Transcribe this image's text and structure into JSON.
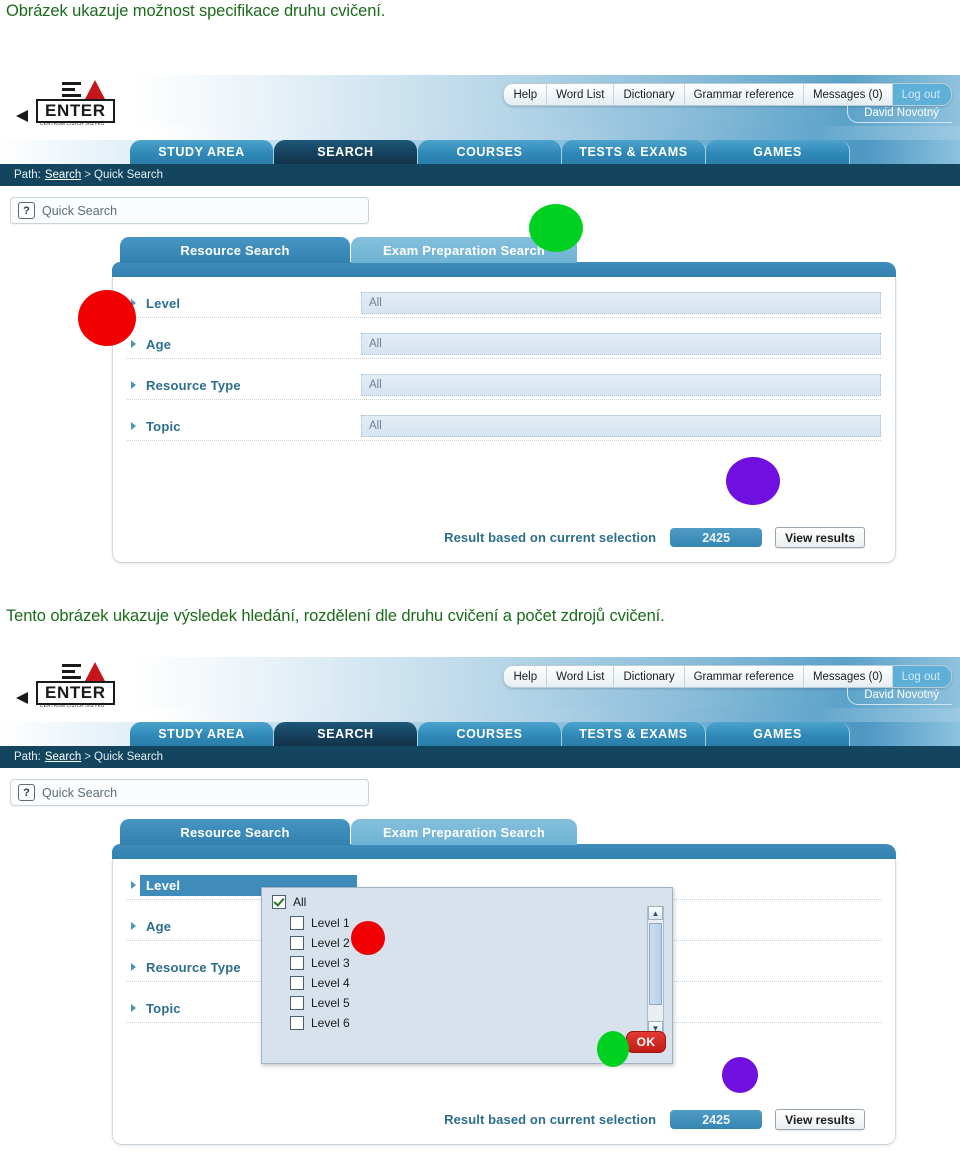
{
  "captions": {
    "first": "Obrázek ukazuje možnost specifikace druhu cvičení.",
    "second": "Tento obrázek ukazuje výsledek hledání, rozdělení dle druhu cvičení a počet zdrojů cvičení."
  },
  "colors": {
    "caption_green": "#1b6b1b",
    "header_blue": "#3382b1",
    "active_tab_navy": "#153f5b",
    "path_bar": "#13465e",
    "blob_red": "#f00000",
    "blob_green": "#00d020",
    "blob_purple": "#7010e0",
    "ok_red": "#c21d14"
  },
  "logo": {
    "word": "ENTER",
    "subtitle": "CENTRUM CIZÍCH JAZYKŮ",
    "url": "www.iENTER.cz"
  },
  "topnav": {
    "items": [
      {
        "label": "Help"
      },
      {
        "label": "Word List"
      },
      {
        "label": "Dictionary"
      },
      {
        "label": "Grammar reference"
      },
      {
        "label": "Messages (0)"
      },
      {
        "label": "Log out"
      }
    ],
    "user": "David Novotný"
  },
  "mainmenu": {
    "tabs": [
      {
        "label": "STUDY AREA",
        "active": false
      },
      {
        "label": "SEARCH",
        "active": true
      },
      {
        "label": "COURSES",
        "active": false
      },
      {
        "label": "TESTS & EXAMS",
        "active": false
      },
      {
        "label": "GAMES",
        "active": false
      }
    ]
  },
  "breadcrumb": {
    "prefix": "Path:",
    "link": "Search",
    "separator": ">",
    "current": "Quick Search"
  },
  "quick_search": {
    "icon": "question-mark-icon",
    "label": "Quick Search"
  },
  "panel": {
    "tabs": [
      {
        "label": "Resource Search",
        "active": true
      },
      {
        "label": "Exam Preparation Search",
        "active": false
      }
    ],
    "rows": [
      {
        "label": "Level",
        "value": "All"
      },
      {
        "label": "Age",
        "value": "All"
      },
      {
        "label": "Resource Type",
        "value": "All"
      },
      {
        "label": "Topic",
        "value": "All"
      }
    ],
    "footer": {
      "text": "Result based on current selection",
      "count": "2425",
      "button": "View results"
    }
  },
  "dropdown": {
    "all_label": "All",
    "all_checked": true,
    "options": [
      {
        "label": "Level 1",
        "checked": false
      },
      {
        "label": "Level 2",
        "checked": false
      },
      {
        "label": "Level 3",
        "checked": false
      },
      {
        "label": "Level 4",
        "checked": false
      },
      {
        "label": "Level 5",
        "checked": false
      },
      {
        "label": "Level 6",
        "checked": false
      }
    ],
    "ok_label": "OK",
    "scroll_up": "▲",
    "scroll_down": "▼"
  }
}
